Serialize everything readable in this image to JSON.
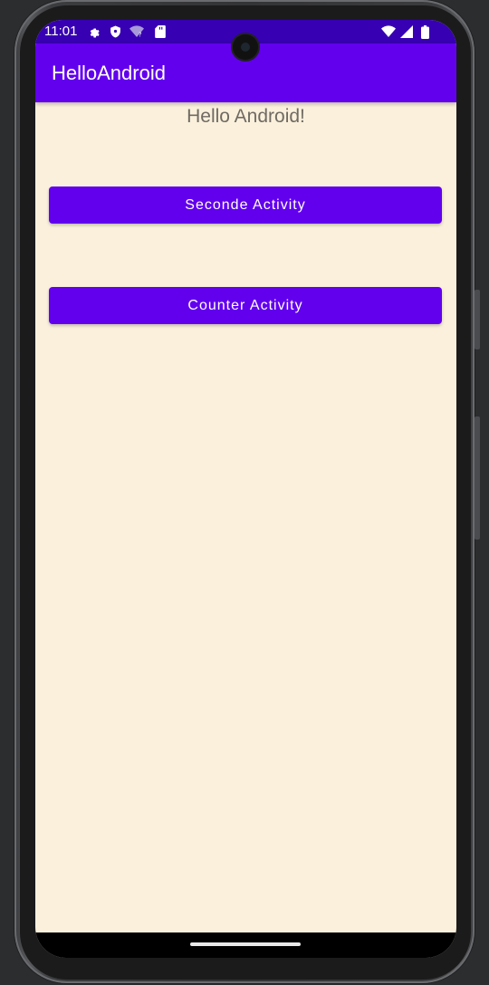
{
  "status_bar": {
    "time": "11:01",
    "icons_left": [
      "gear-icon",
      "shield-icon",
      "wifi-question-icon",
      "sd-card-icon"
    ],
    "icons_right": [
      "wifi-icon",
      "cellular-signal-icon",
      "battery-icon"
    ],
    "color": "#3700b3"
  },
  "app_bar": {
    "title": "HelloAndroid",
    "color": "#6200ee"
  },
  "main": {
    "greeting": "Hello Android!",
    "buttons": [
      {
        "label": "Seconde Activity"
      },
      {
        "label": "Counter Activity"
      }
    ],
    "background": "#faf0dc"
  }
}
